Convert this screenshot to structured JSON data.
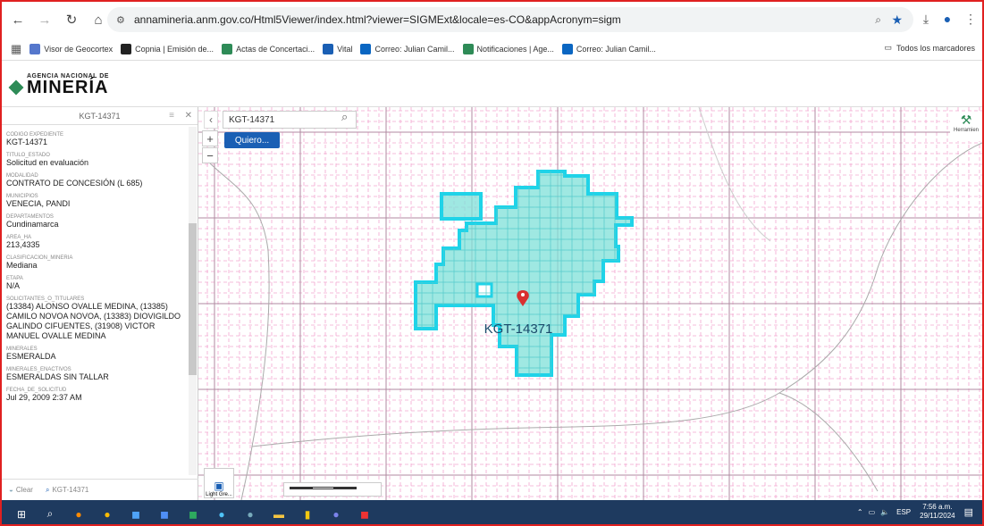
{
  "browser": {
    "url": "annamineria.anm.gov.co/Html5Viewer/index.html?viewer=SIGMExt&locale=es-CO&appAcronym=sigm"
  },
  "bookmarks": [
    {
      "label": "Visor de Geocortex",
      "color": "#5577cc"
    },
    {
      "label": "Copnia | Emisión de...",
      "color": "#222222"
    },
    {
      "label": "Actas de Concertaci...",
      "color": "#2e8b57"
    },
    {
      "label": "Vital",
      "color": "#1a5fb4"
    },
    {
      "label": "Correo: Julian Camil...",
      "color": "#0a66c2"
    },
    {
      "label": "Notificaciones | Age...",
      "color": "#2e8b57"
    },
    {
      "label": "Correo: Julian Camil...",
      "color": "#0a66c2"
    }
  ],
  "all_bookmarks": "Todos los marcadores",
  "logo": {
    "small": "AGENCIA NACIONAL DE",
    "big": "MINERÍA"
  },
  "panel": {
    "title": "KGT-14371",
    "fields": [
      {
        "label": "Codigo Expediente",
        "value": "KGT-14371"
      },
      {
        "label": "TITULO_ESTADO",
        "value": "Solicitud en evaluación"
      },
      {
        "label": "MODALIDAD",
        "value": "CONTRATO DE CONCESIÓN (L 685)"
      },
      {
        "label": "MUNICIPIOS",
        "value": "VENECIA, PANDI"
      },
      {
        "label": "DEPARTAMENTOS",
        "value": "Cundinamarca"
      },
      {
        "label": "AREA_HA",
        "value": "213,4335"
      },
      {
        "label": "CLASIFICACION_MINERIA",
        "value": "Mediana"
      },
      {
        "label": "ETAPA",
        "value": "N/A"
      },
      {
        "label": "SOLICITANTES_O_TITULARES",
        "value": "(13384) ALONSO OVALLE MEDINA, (13385) CAMILO NOVOA NOVOA, (13383) DIOVIGILDO GALINDO CIFUENTES, (31908) VICTOR MANUEL OVALLE MEDINA"
      },
      {
        "label": "MINERALES",
        "value": "ESMERALDA"
      },
      {
        "label": "MINERALES_ENACTIVOS",
        "value": "ESMERALDAS SIN TALLAR"
      },
      {
        "label": "FECHA_DE_SOLICITUD",
        "value": "Jul 29, 2009 2:37 AM"
      }
    ],
    "footer_clear": "Clear",
    "footer_tab": "KGT-14371"
  },
  "map": {
    "search_value": "KGT-14371",
    "quiero_label": "Quiero...",
    "tools_label": "Herramien",
    "polygon_label": "KGT-14371",
    "basemap_label": "Light Gre...",
    "polygon_color": "#7fe0d8",
    "outline_color": "#1fd3e8"
  },
  "taskbar": {
    "lang": "ESP",
    "time": "7:56 a.m.",
    "date": "29/11/2024"
  }
}
